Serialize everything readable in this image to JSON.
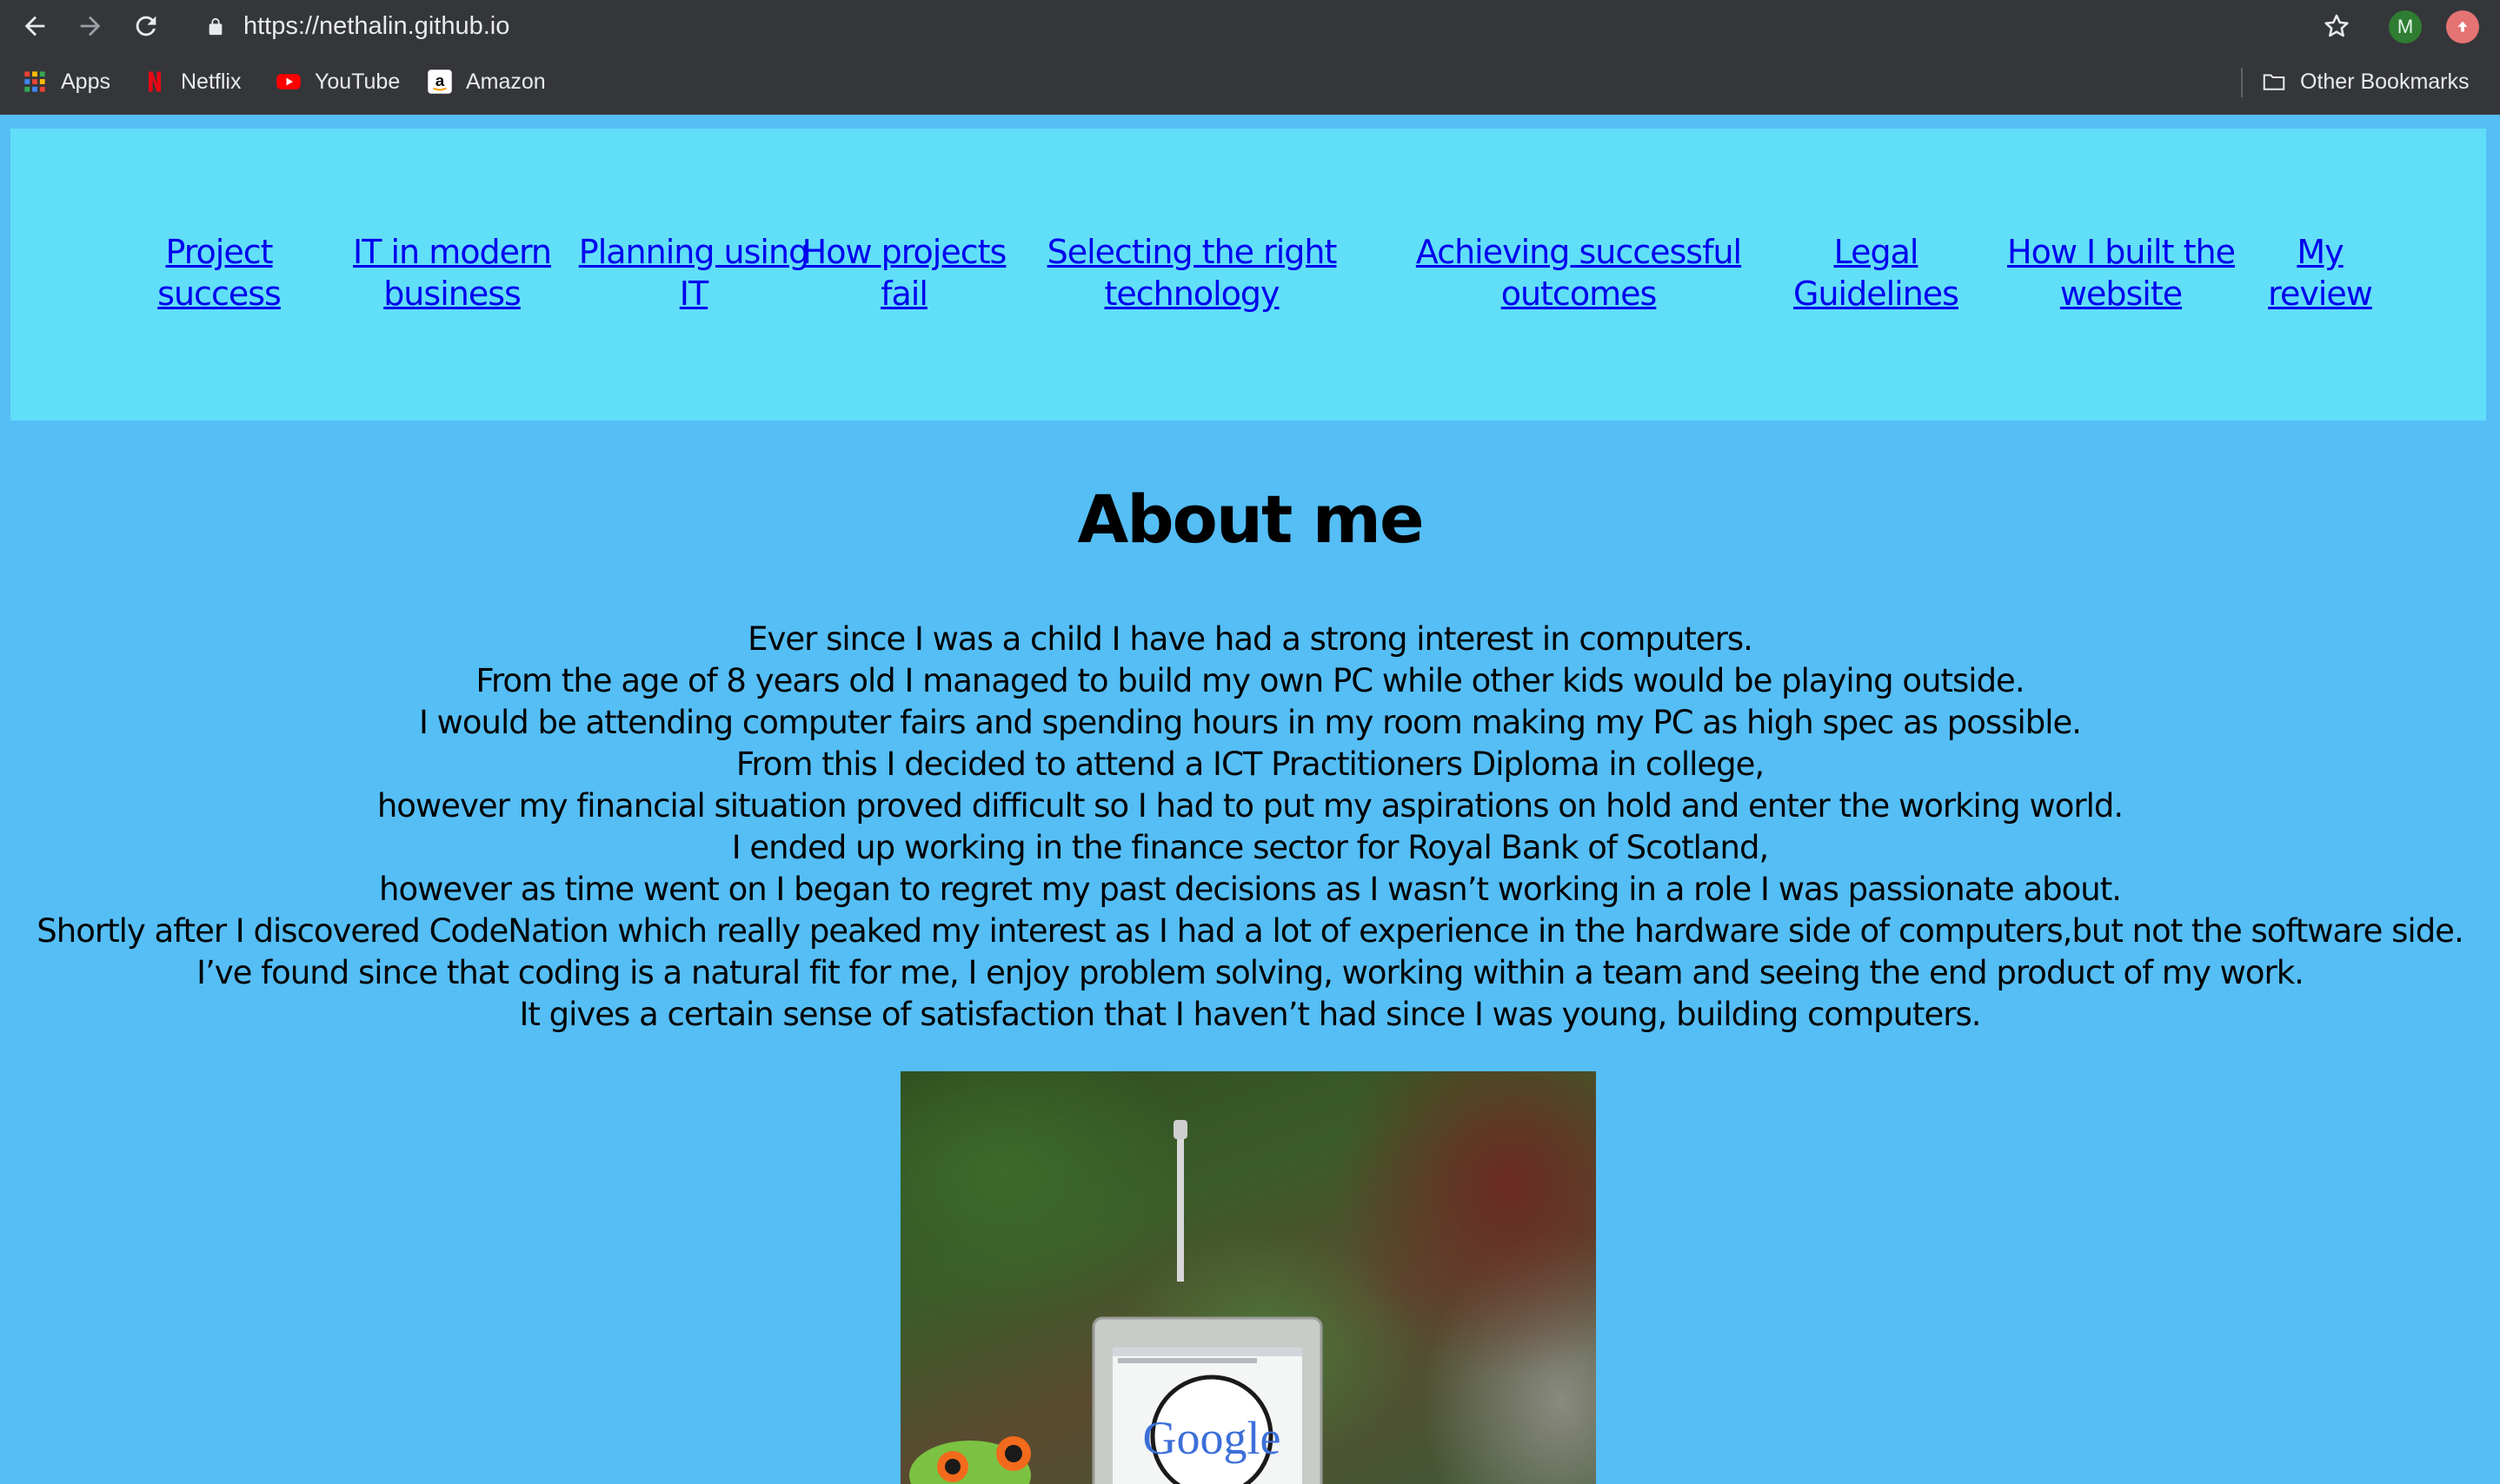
{
  "browser": {
    "url": "https://nethalin.github.io",
    "profile_initial": "M",
    "bookmarks": [
      {
        "label": "Apps",
        "icon": "apps-grid-icon"
      },
      {
        "label": "Netflix",
        "icon": "netflix-icon"
      },
      {
        "label": "YouTube",
        "icon": "youtube-icon"
      },
      {
        "label": "Amazon",
        "icon": "amazon-icon"
      }
    ],
    "other_bookmarks": "Other Bookmarks"
  },
  "nav": {
    "links": [
      {
        "line1": "Project",
        "line2": "success"
      },
      {
        "line1": "IT in modern",
        "line2": "business"
      },
      {
        "line1": "Planning using",
        "line2": "IT"
      },
      {
        "line1": "How projects",
        "line2": "fail"
      },
      {
        "line1": "Selecting the right",
        "line2": "technology"
      },
      {
        "line1": "Achieving successful",
        "line2": "outcomes"
      },
      {
        "line1": "Legal",
        "line2": "Guidelines"
      },
      {
        "line1": "How I built the",
        "line2": "website"
      },
      {
        "line1": "My",
        "line2": "review"
      }
    ]
  },
  "main": {
    "title": "About me",
    "bio": [
      "Ever since I was a child I have had a strong interest in computers.",
      "From the age of 8 years old I managed to build my own PC while other kids would be playing outside.",
      "I would be attending computer fairs and spending hours in my room making my PC as high spec as possible.",
      "From this I decided to attend a ICT Practitioners Diploma in college,",
      "however my financial situation proved difficult so I had to put my aspirations on hold and enter the working world.",
      "I ended up working in the finance sector for Royal Bank of Scotland,",
      "however as time went on I began to regret my past decisions as I wasn’t working in a role I was passionate about.",
      "Shortly after I discovered CodeNation which really peaked my interest as I had a lot of experience in the hardware side of computers,but not the software side.",
      "I’ve found since that coding is a natural fit for me, I enjoy problem solving, working within a team and seeing the end product of my work.",
      "It gives a certain sense of satisfaction that I haven’t had since I was young, building computers."
    ],
    "photo_logo_text": "Google"
  }
}
